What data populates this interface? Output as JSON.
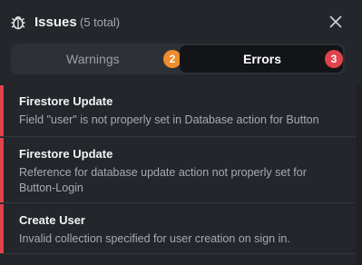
{
  "header": {
    "icon": "bug-icon",
    "title": "Issues",
    "count": "(5 total)",
    "close_icon": "close-icon"
  },
  "tabs": [
    {
      "label": "Warnings",
      "badge": "2",
      "badge_color": "#f08c2e",
      "selected": false
    },
    {
      "label": "Errors",
      "badge": "3",
      "badge_color": "#e0434b",
      "selected": true
    }
  ],
  "issues": [
    {
      "title": "Firestore Update",
      "description": "Field \"user\" is not properly set in Database action for Button"
    },
    {
      "title": "Firestore Update",
      "description": "Reference for database update action not properly set for Button-Login"
    },
    {
      "title": "Create User",
      "description": "Invalid collection specified for user creation on sign in."
    }
  ],
  "colors": {
    "error": "#e0434b",
    "warning": "#f08c2e",
    "background": "#23262a"
  }
}
